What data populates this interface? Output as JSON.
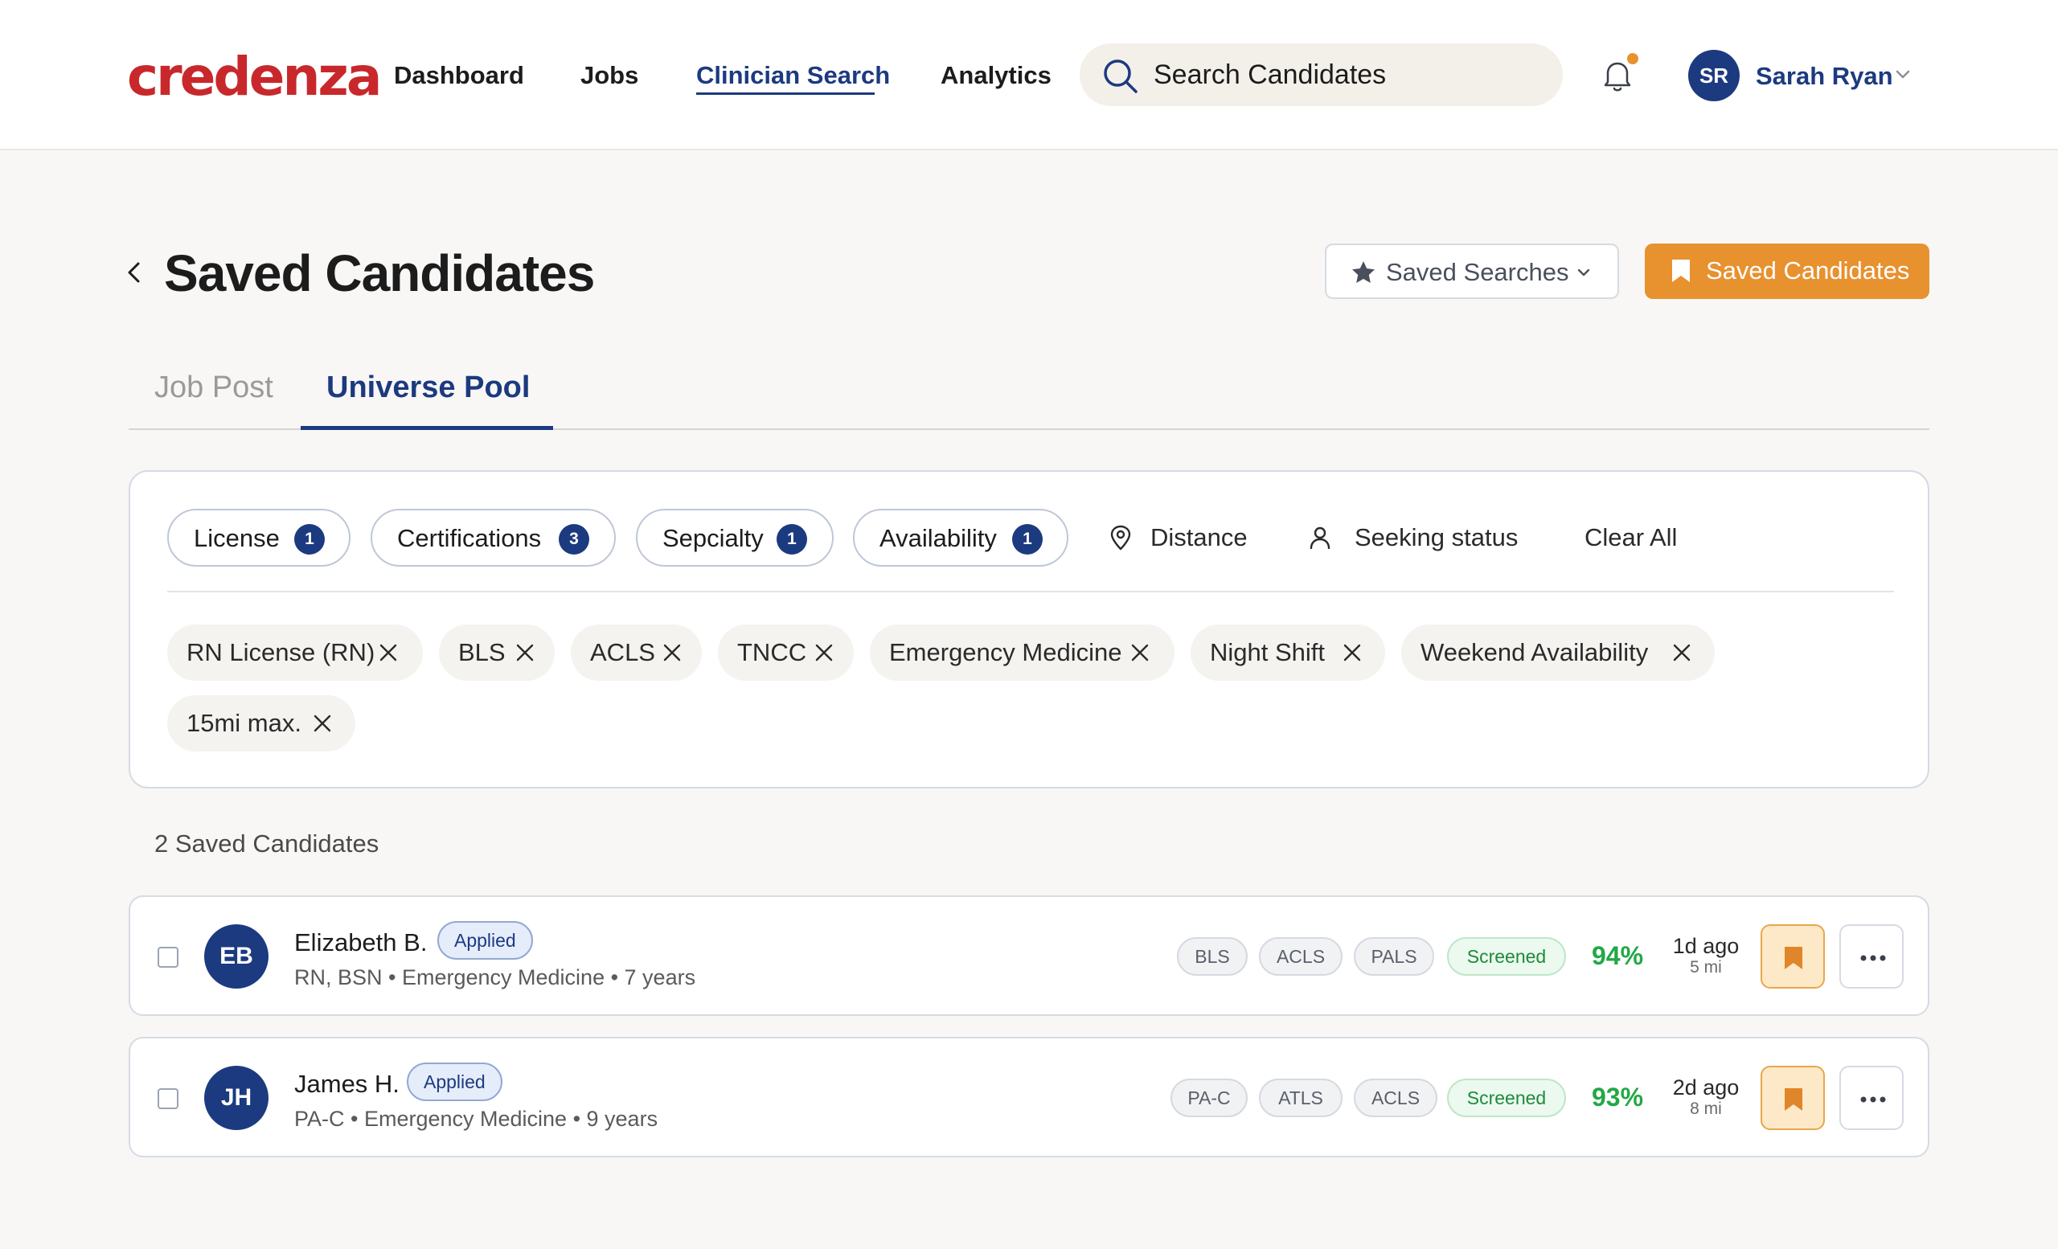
{
  "app": {
    "logo": "credenza",
    "nav": [
      "Dashboard",
      "Jobs",
      "Clinician Search",
      "Analytics"
    ],
    "active_nav": "Clinician Search",
    "search_placeholder": "Search Candidates",
    "user": {
      "initials": "SR",
      "name": "Sarah Ryan"
    },
    "colors": {
      "brand": "#c8282b",
      "primary": "#1c3a80",
      "accent": "#e8912f",
      "success": "#22a845"
    }
  },
  "page": {
    "title": "Saved Candidates",
    "saved_searches_label": "Saved Searches",
    "saved_candidates_label": "Saved Candidates"
  },
  "tabs": {
    "items": [
      "Job Post",
      "Universe Pool"
    ],
    "active": "Universe Pool"
  },
  "filters": {
    "chips": [
      {
        "label": "License",
        "count": "1"
      },
      {
        "label": "Certifications",
        "count": "3"
      },
      {
        "label": "Sepcialty",
        "count": "1"
      },
      {
        "label": "Availability",
        "count": "1"
      }
    ],
    "distance": "Distance",
    "seeking_status": "Seeking status",
    "clear_all": "Clear All",
    "active_tags": [
      "RN License (RN)",
      "BLS",
      "ACLS",
      "TNCC",
      "Emergency Medicine",
      "Night Shift",
      "Weekend Availability",
      "15mi max."
    ]
  },
  "results": {
    "count_label": "2 Saved Candidates",
    "candidates": [
      {
        "initials": "EB",
        "name": "Elizabeth B.",
        "status": "Applied",
        "subtitle": "RN, BSN • Emergency Medicine • 7 years",
        "certs": [
          "BLS",
          "ACLS",
          "PALS"
        ],
        "screened": "Screened",
        "match": "94%",
        "ago": "1d ago",
        "distance": "5 mi",
        "saved": true
      },
      {
        "initials": "JH",
        "name": "James H.",
        "status": "Applied",
        "subtitle": "PA-C • Emergency Medicine • 9 years",
        "certs": [
          "PA-C",
          "ATLS",
          "ACLS"
        ],
        "screened": "Screened",
        "match": "93%",
        "ago": "2d ago",
        "distance": "8 mi",
        "saved": true
      }
    ]
  }
}
